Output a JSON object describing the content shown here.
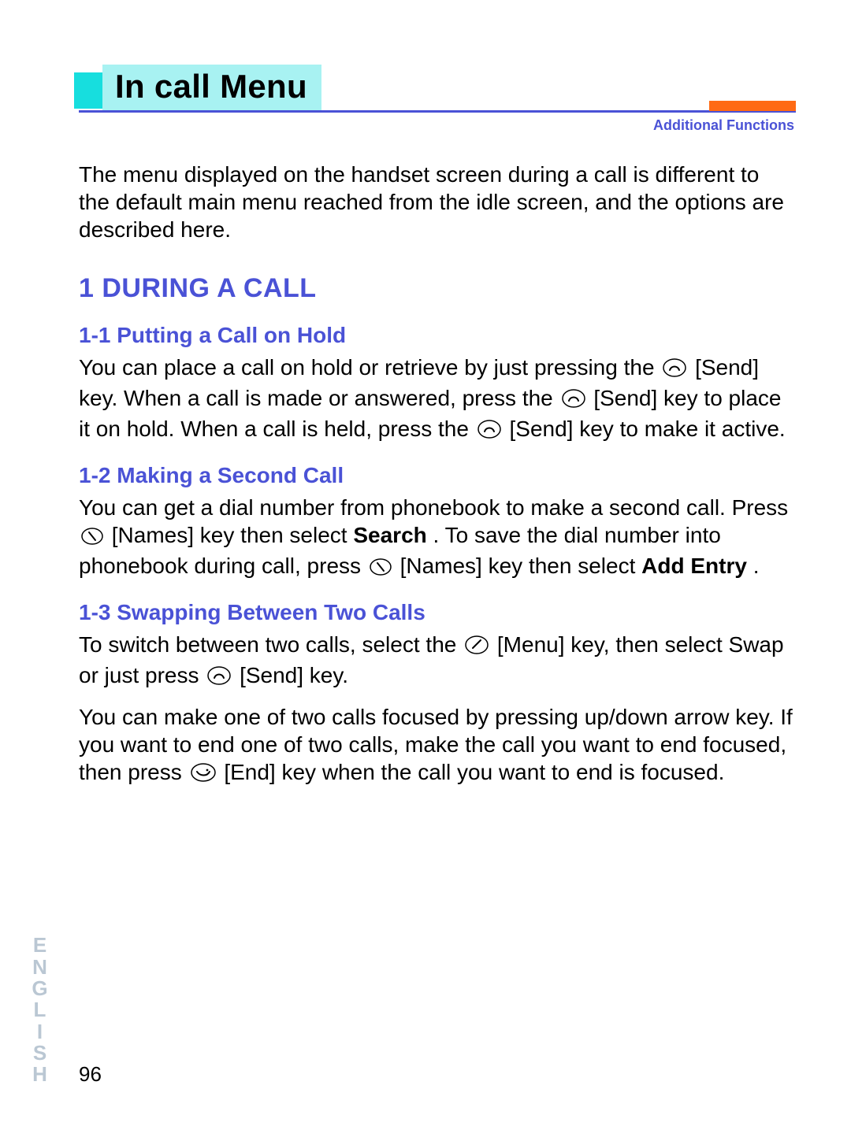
{
  "header": {
    "title": "In call Menu",
    "functions_label": "Additional Functions"
  },
  "intro": "The menu displayed on the handset screen during a call is different to the default main menu reached from the idle screen, and the options are described here.",
  "section1": {
    "num_title": "1  DURING A CALL",
    "s11": {
      "title": "1-1  Putting a Call on Hold",
      "p1a": "You can place a call on hold or retrieve by just pressing the ",
      "p1b": " [Send] key. When a call is made or answered, press the ",
      "p1c": " [Send] key to place it on hold. When a call is held, press the ",
      "p1d": " [Send] key to make it active."
    },
    "s12": {
      "title": "1-2  Making a Second Call",
      "p1a": "You can get a dial number from phonebook to make a second call. Press ",
      "p1b": " [Names] key then select ",
      "bold1": "Search",
      "p1c": ". To save the dial number into phonebook during call, press ",
      "p1d": " [Names] key then select ",
      "bold2": "Add Entry",
      "p1e": "."
    },
    "s13": {
      "title": "1-3  Swapping Between Two Calls",
      "p1a": "To switch between two calls, select the ",
      "p1b": " [Menu] key, then select Swap or just press ",
      "p1c": " [Send] key.",
      "p2a": "You can make one of two calls focused by pressing up/down arrow key. If you want to end one of two calls, make the call you want to end focused, then press ",
      "p2b": " [End] key when the call you want to end is focused."
    }
  },
  "sidebar": {
    "language": "ENGLISH"
  },
  "page_number": "96"
}
